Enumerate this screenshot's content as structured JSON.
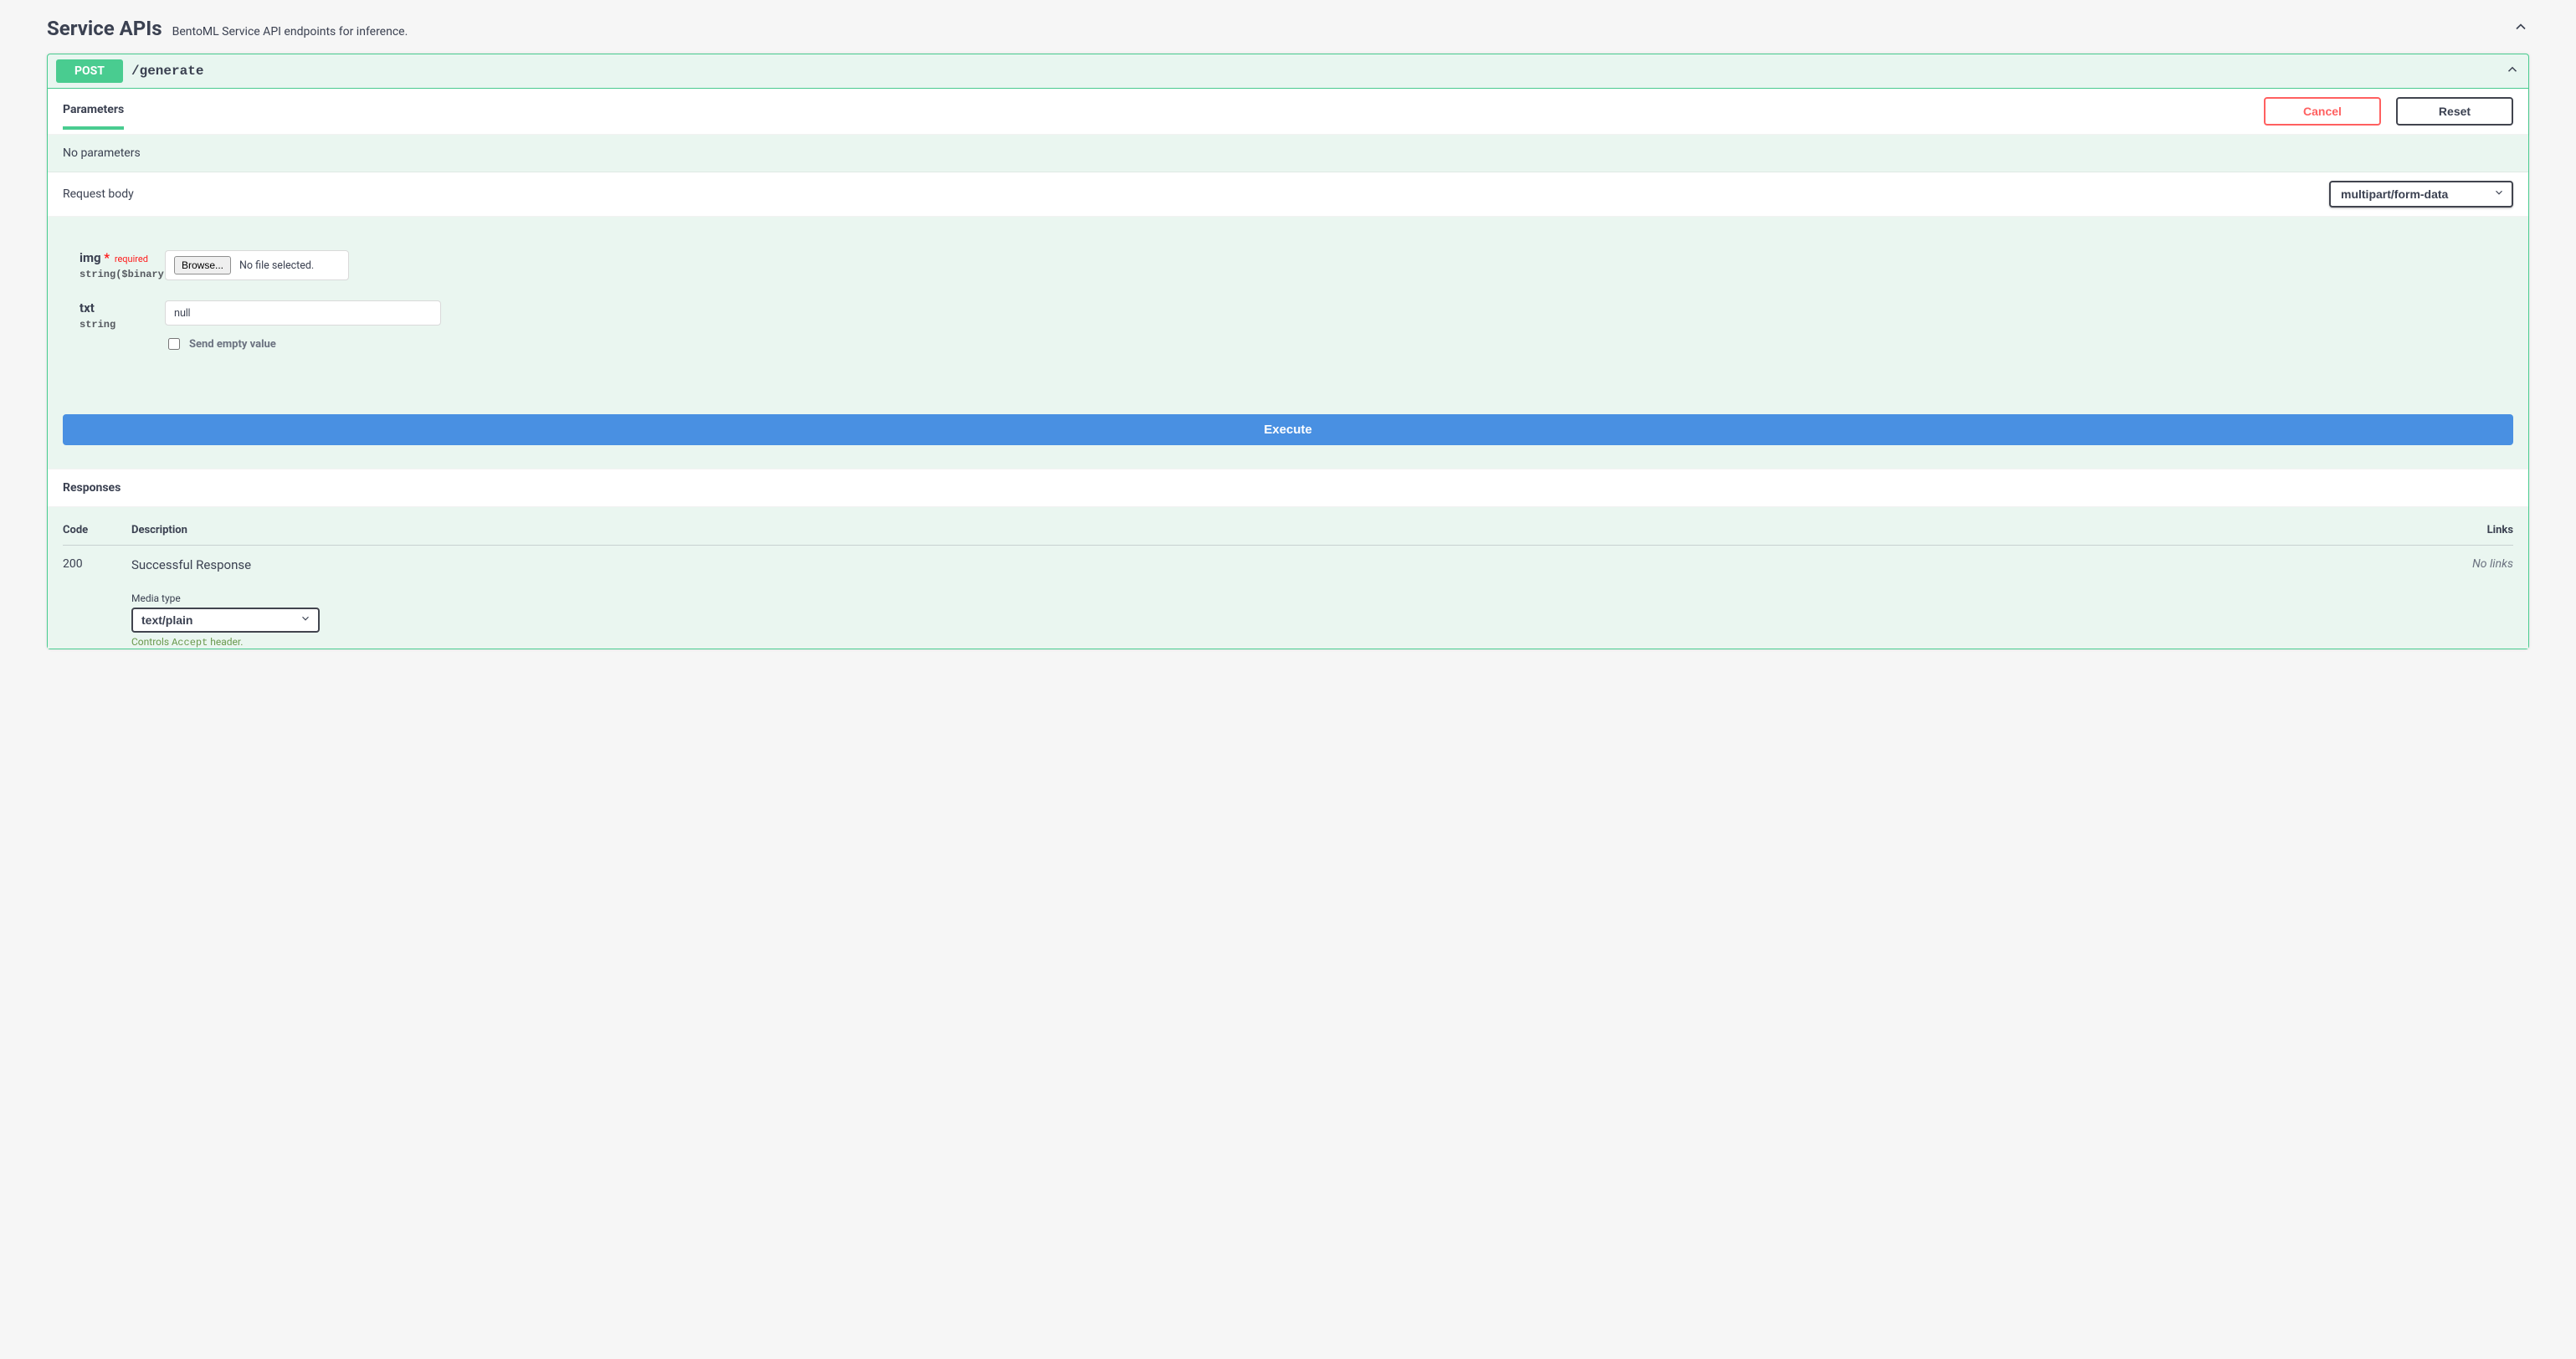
{
  "section": {
    "title": "Service APIs",
    "description": "BentoML Service API endpoints for inference."
  },
  "op": {
    "method": "POST",
    "path": "/generate"
  },
  "params": {
    "tab_label": "Parameters",
    "cancel_label": "Cancel",
    "reset_label": "Reset",
    "empty_text": "No parameters"
  },
  "request_body": {
    "label": "Request body",
    "content_type": "multipart/form-data",
    "fields": {
      "img": {
        "name": "img",
        "required_marker": "*",
        "required_text": "required",
        "type": "string($binary)",
        "browse_label": "Browse...",
        "file_status": "No file selected."
      },
      "txt": {
        "name": "txt",
        "type": "string",
        "value": "null",
        "send_empty_label": "Send empty value"
      }
    },
    "execute_label": "Execute"
  },
  "responses": {
    "header": "Responses",
    "col_code": "Code",
    "col_desc": "Description",
    "col_links": "Links",
    "row": {
      "code": "200",
      "description": "Successful Response",
      "links": "No links",
      "media_type_label": "Media type",
      "media_type": "text/plain",
      "controls_hint_prefix": "Controls ",
      "controls_hint_code": "Accept",
      "controls_hint_suffix": " header."
    }
  }
}
